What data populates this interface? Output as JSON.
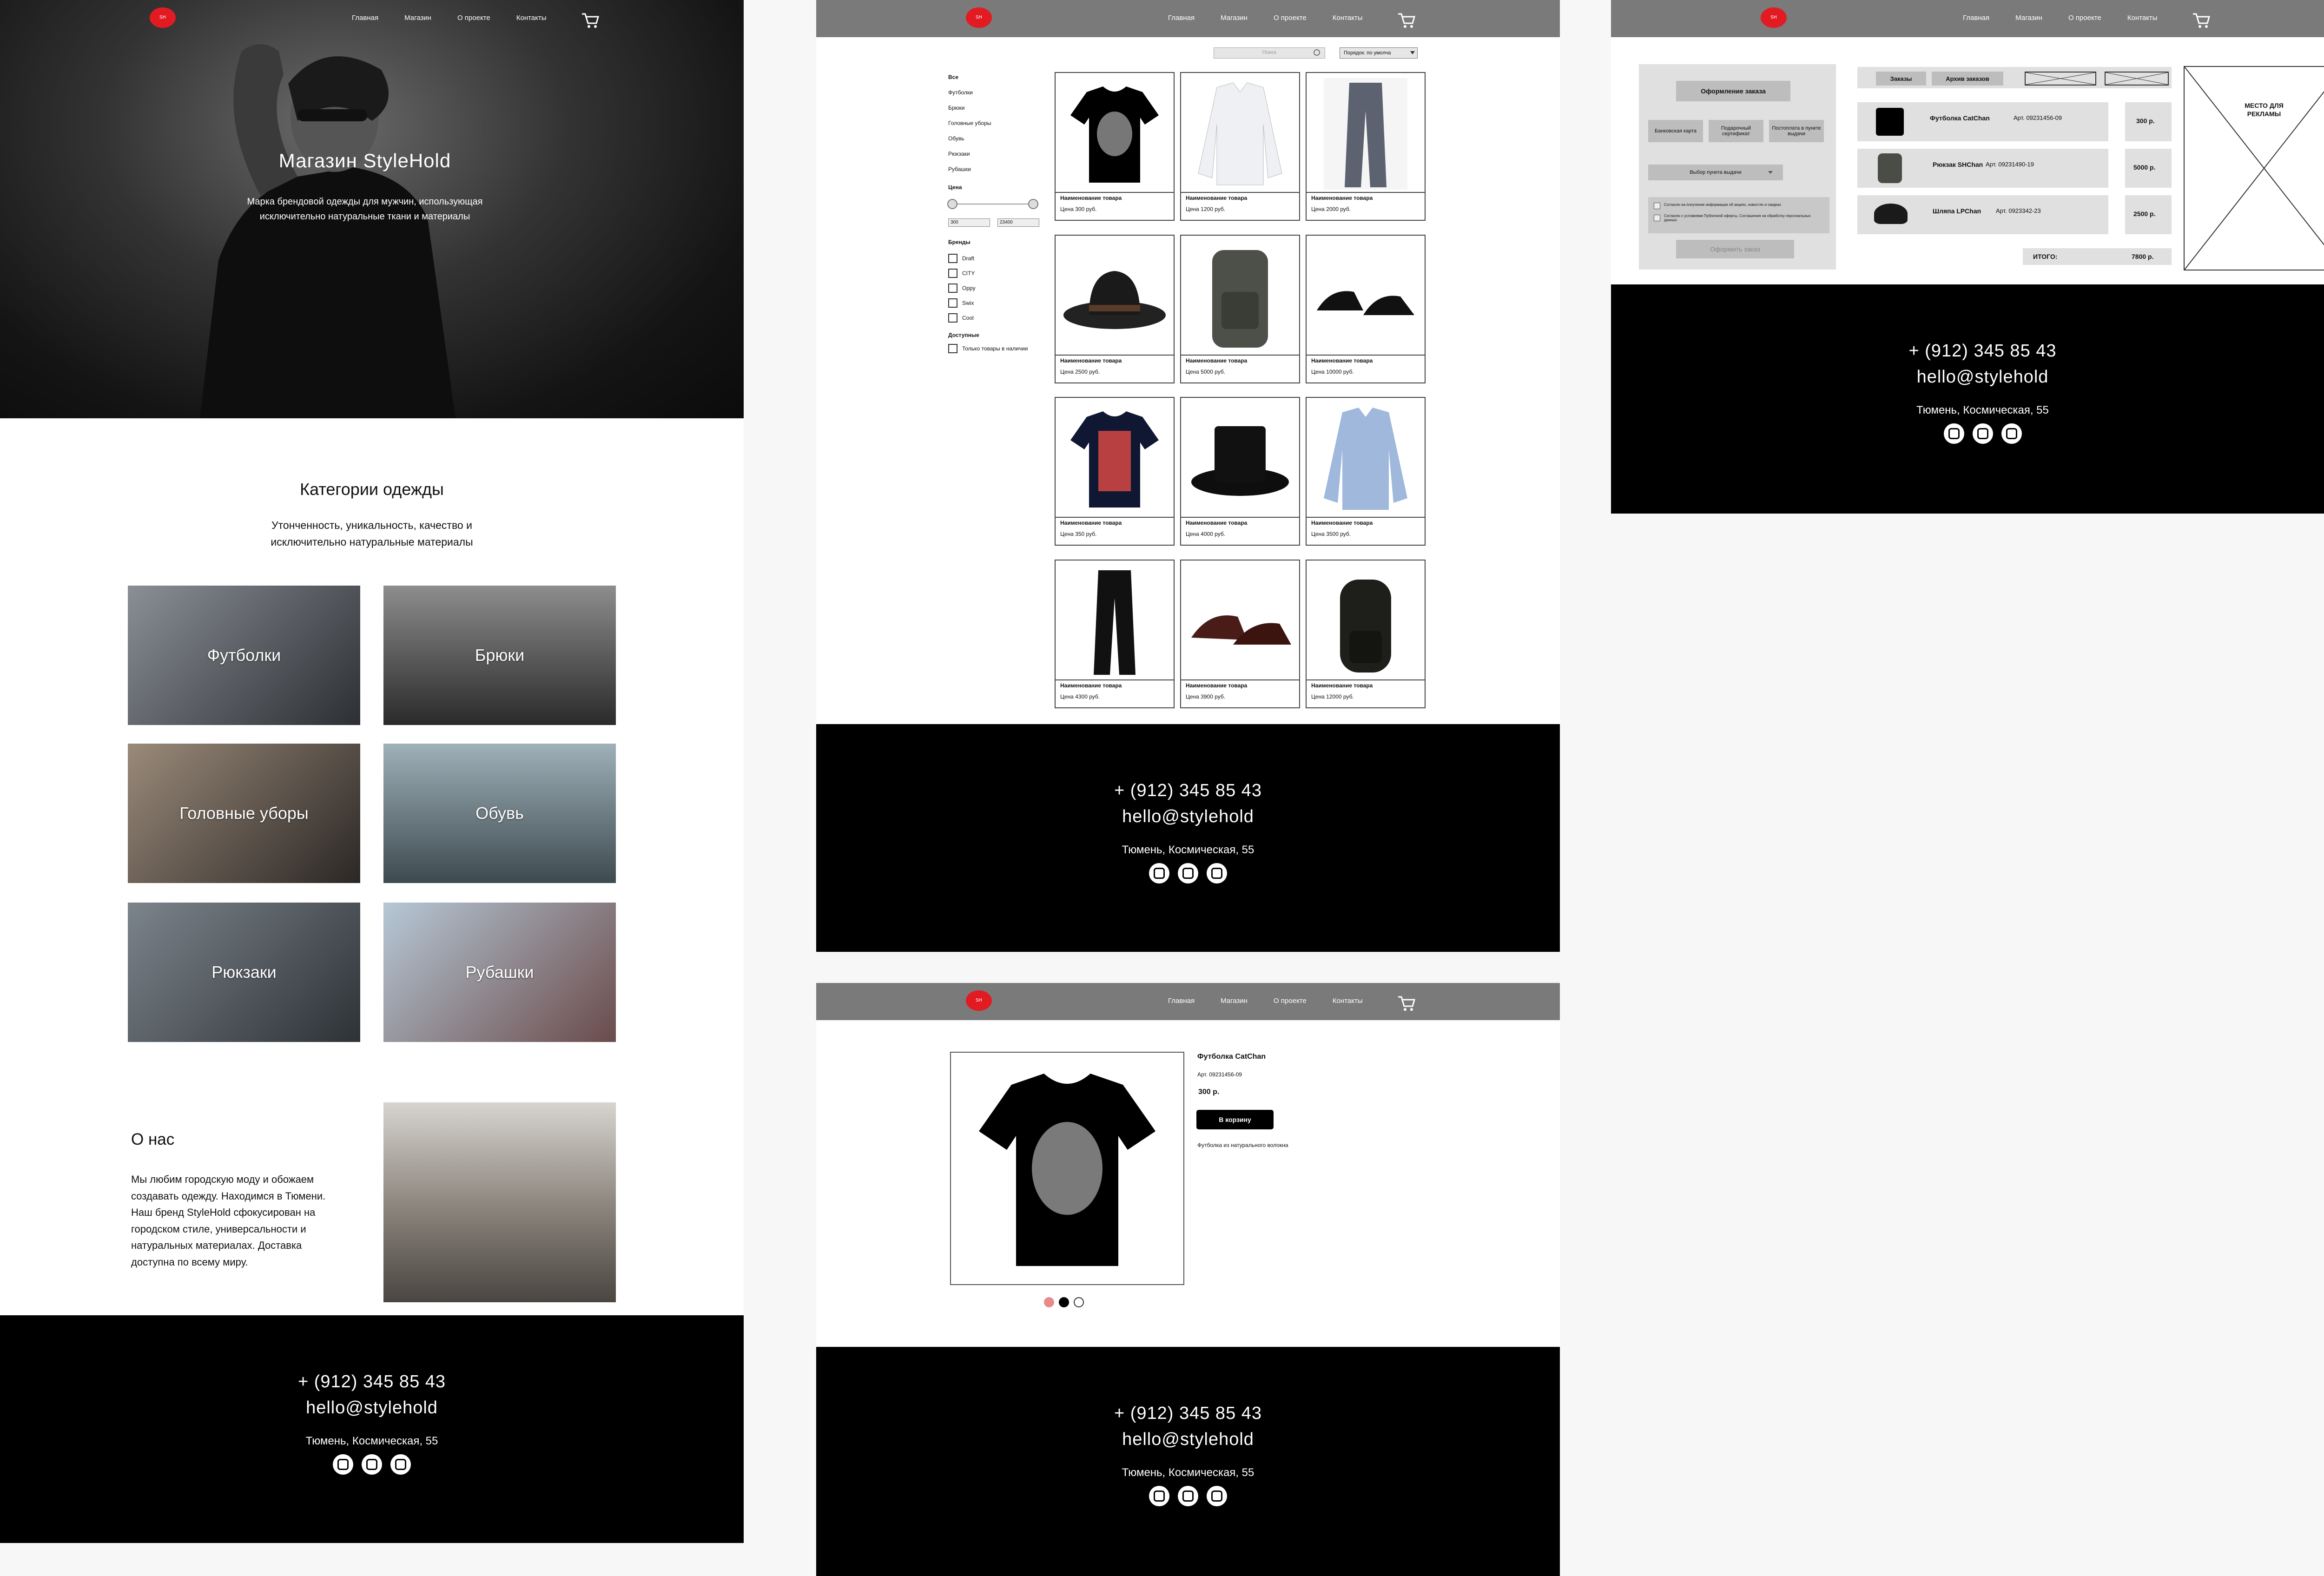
{
  "nav": {
    "logo_text": "SH",
    "links": [
      "Главная",
      "Магазин",
      "О проекте",
      "Контакты"
    ]
  },
  "home": {
    "hero_title": "Магазин StyleHold",
    "hero_sub_1": "Марка брендовой одежды для мужчин, использующая",
    "hero_sub_2": "исключительно натуральные ткани и материалы",
    "cat_title": "Категории одежды",
    "cat_sub_1": "Утонченность, уникальность, качество и",
    "cat_sub_2": "исключительно натуральные материалы",
    "categories": [
      "Футболки",
      "Брюки",
      "Головные уборы",
      "Обувь",
      "Рюкзаки",
      "Рубашки"
    ],
    "about_title": "О нас",
    "about_lines": [
      "Мы любим городскую моду и обожаем",
      "создавать одежду. Находимся в Тюмени.",
      "Наш бренд StyleHold  сфокусирован на",
      "городском стиле, универсальности и",
      "натуральных материалах. Доставка",
      "доступна по всему миру."
    ]
  },
  "footer": {
    "phone": "+ (912) 345 85 43",
    "email": "hello@stylehold",
    "address": "Тюмень, Космическая, 55"
  },
  "shop": {
    "search_placeholder": "Поиск",
    "sort_label": "Порядок: по умолча",
    "categories": [
      "Все",
      "Футболки",
      "Брюки",
      "Головные уборы",
      "Обувь",
      "Рюкзаки",
      "Рубашки"
    ],
    "price_label": "Цена",
    "price_min": "300",
    "price_max": "23400",
    "brands_label": "Бренды",
    "brands": [
      "Draft",
      "CITY",
      "Oppy",
      "Swix",
      "Cool"
    ],
    "avail_label": "Доступные",
    "avail_option": "Только товары в наличии",
    "product_name": "Наименование товара",
    "prices": [
      "Цена 300 руб.",
      "Цена 1200 руб.",
      "Цена 2000 руб.",
      "Цена 2500 руб.",
      "Цена 5000 руб.",
      "Цена 10000 руб.",
      "Цена 350 руб.",
      "Цена 4000 руб.",
      "Цена 3500 руб.",
      "Цена 4300 руб.",
      "Цена 3900 руб.",
      "Цена 12000 руб."
    ]
  },
  "product": {
    "title": "Футболка CatChan",
    "article": "Арт. 09231456-09",
    "price": "300 р.",
    "button": "В корзину",
    "description": "Футболка из натурального волокна"
  },
  "cart": {
    "checkout_title": "Оформление заказа",
    "pay_options": [
      "Банковская карта",
      "Подарочный сертификат",
      "Постоплата в пункте выдачи"
    ],
    "pickup_select": "Выбор пункта выдачи",
    "consent_1": "Согласен на получение информации об акциях, новостях и скидках",
    "consent_2": "Согласен с условиями Публичной оферты, Соглашения на обработку персональных данных",
    "submit": "Оформить заказ",
    "tabs": [
      "Заказы",
      "Архив заказов"
    ],
    "items": [
      {
        "name": "Футболка CatChan",
        "article": "Арт. 09231456-09",
        "price": "300 р."
      },
      {
        "name": "Рюкзак SHChan",
        "article": "Арт. 09231490-19",
        "price": "5000 р."
      },
      {
        "name": "Шляпа LPChan",
        "article": "Арт. 0923342-23",
        "price": "2500 р."
      }
    ],
    "total_label": "ИТОГО:",
    "total_value": "7800 р.",
    "ad_line1": "МЕСТО ДЛЯ",
    "ad_line2": "РЕКЛАМЫ"
  },
  "colors": {
    "brand_red": "#e21b23",
    "nav_grey": "#7a7a7a",
    "footer": "#000000",
    "dot_active": "#000000",
    "dot_pink": "#e88a8a"
  }
}
